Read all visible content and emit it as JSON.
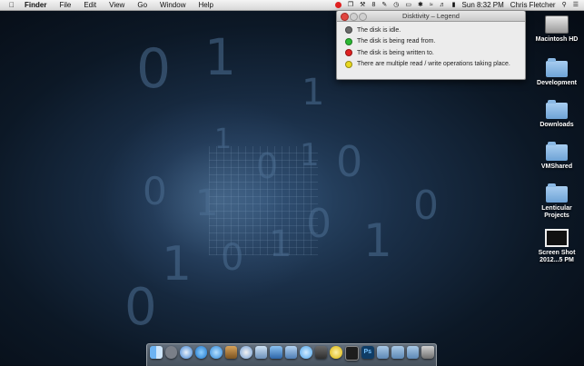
{
  "menubar": {
    "app": "Finder",
    "items": [
      "File",
      "Edit",
      "View",
      "Go",
      "Window",
      "Help"
    ],
    "status_count": "8",
    "clock": "Sun 8:32 PM",
    "user": "Chris Fletcher"
  },
  "window": {
    "title": "Disktivity – Legend",
    "legend": [
      {
        "color": "#6b6b6b",
        "text": "The disk is idle."
      },
      {
        "color": "#2bb832",
        "text": "The disk is being read from."
      },
      {
        "color": "#e02020",
        "text": "The disk is being written to."
      },
      {
        "color": "#e8d81e",
        "text": "There are multiple read / write operations taking place."
      }
    ]
  },
  "desktop_icons": [
    {
      "label": "Macintosh HD",
      "icon": "hard-drive-icon"
    },
    {
      "label": "Development",
      "icon": "folder-icon"
    },
    {
      "label": "Downloads",
      "icon": "folder-icon"
    },
    {
      "label": "VMShared",
      "icon": "folder-icon"
    },
    {
      "label": "Lenticular Projects",
      "icon": "folder-icon"
    },
    {
      "label": "Screen Shot 2012...5 PM",
      "icon": "screenshot-icon"
    }
  ],
  "dock_icons": [
    "finder-icon",
    "launchpad-icon",
    "safari-icon",
    "app-store-icon",
    "itunes-icon",
    "photos-icon",
    "safari-2-icon",
    "preview-icon",
    "xcode-icon",
    "dashboard-icon",
    "messages-icon",
    "facetime-icon",
    "quicktime-icon",
    "terminal-icon",
    "photoshop-icon",
    "folder-stack-icon",
    "folder-stack-2-icon",
    "folder-stack-3-icon",
    "trash-icon"
  ],
  "colors": {
    "accent": "#1f78d1"
  }
}
